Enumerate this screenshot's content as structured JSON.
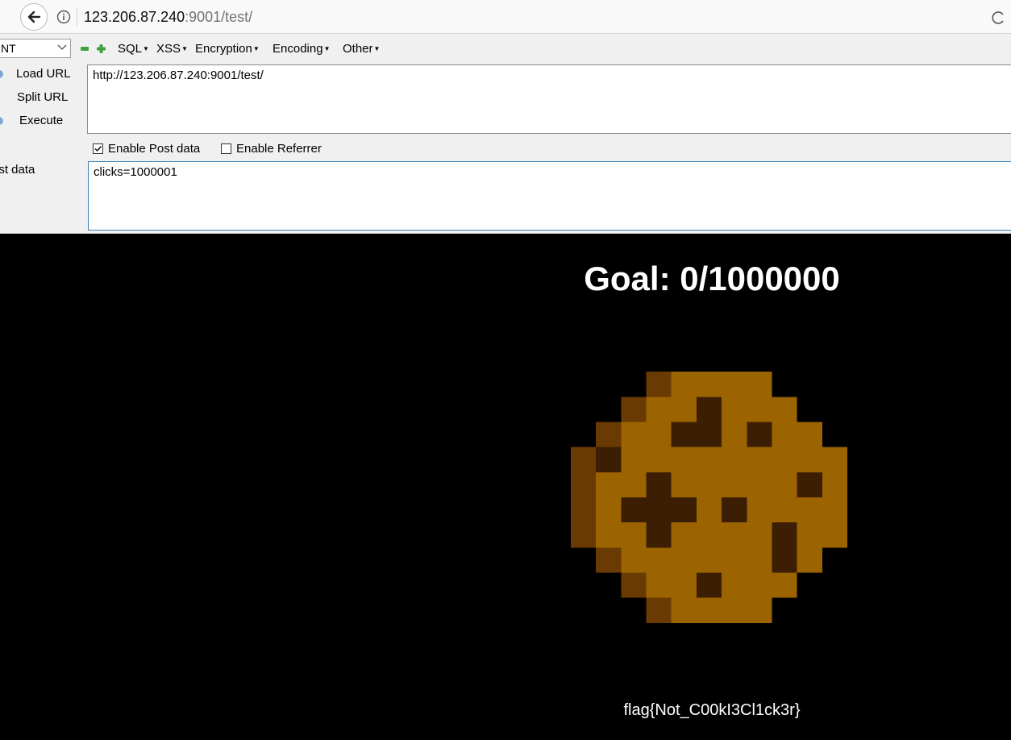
{
  "browser": {
    "url_host": "123.206.87.240",
    "url_rest": ":9001/test/"
  },
  "hackbar": {
    "select_value": "NT",
    "menus": [
      "SQL",
      "XSS",
      "Encryption",
      "Encoding",
      "Other"
    ],
    "buttons": {
      "load_url": "Load URL",
      "split_url": "Split URL",
      "execute": "Execute"
    },
    "url_value": "http://123.206.87.240:9001/test/",
    "enable_post_label": "Enable Post data",
    "enable_post_checked": true,
    "enable_referrer_label": "Enable Referrer",
    "enable_referrer_checked": false,
    "post_label": "ost data",
    "post_value": "clicks=1000001"
  },
  "page": {
    "goal_text": "Goal: 0/1000000",
    "flag_text": "flag{Not_C00kI3Cl1ck3r}",
    "background_color": "#000000",
    "cookie_colors": {
      "dough": "#9c6400",
      "chip": "#3c1e04",
      "shadow": "#6a3a03"
    }
  }
}
